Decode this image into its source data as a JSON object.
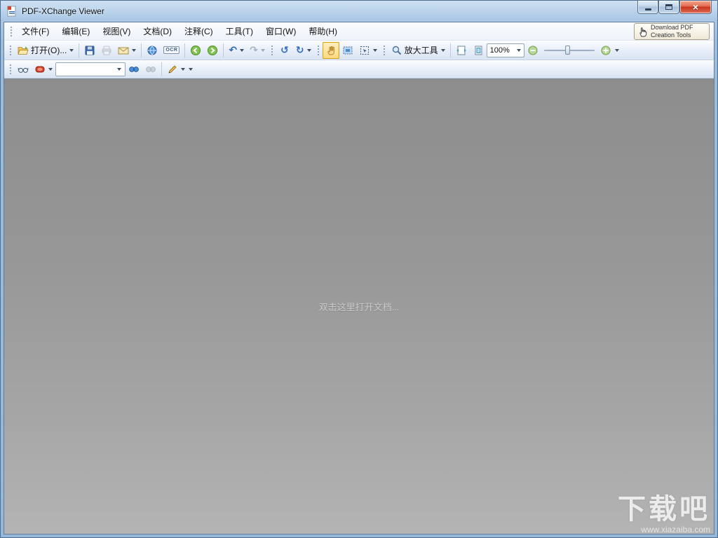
{
  "window": {
    "title": "PDF-XChange Viewer"
  },
  "menubar": {
    "items": [
      "文件(F)",
      "编辑(E)",
      "视图(V)",
      "文档(D)",
      "注释(C)",
      "工具(T)",
      "窗口(W)",
      "帮助(H)"
    ],
    "download_button": {
      "line1": "Download PDF",
      "line2": "Creation Tools"
    }
  },
  "toolbar1": {
    "open_label": "打开(O)...",
    "ocr_label": "OCR",
    "zoom_tool_label": "放大工具",
    "zoom_value": "100%"
  },
  "toolbar2": {
    "search_value": ""
  },
  "content": {
    "placeholder": "双击这里打开文档..."
  },
  "watermark": {
    "title": "下载吧",
    "url": "www.xiazaiba.com"
  },
  "glyphs": {
    "undo": "↶",
    "redo": "↷",
    "rotate_ccw": "↺",
    "rotate_cw": "↻"
  },
  "icons": [
    "app-icon",
    "minimize-icon",
    "maximize-icon",
    "close-icon",
    "grip-handle",
    "open-folder-icon",
    "save-icon",
    "print-icon",
    "email-icon",
    "browser-icon",
    "ocr-icon",
    "previous-view-icon",
    "next-view-icon",
    "undo-icon",
    "redo-icon",
    "rotate-ccw-icon",
    "rotate-cw-icon",
    "hand-tool-icon",
    "snapshot-icon",
    "select-tool-icon",
    "magnifier-icon",
    "fit-width-icon",
    "fit-page-icon",
    "zoom-out-icon",
    "zoom-in-icon",
    "glasses-icon",
    "stamp-icon",
    "search-icon",
    "search-again-icon",
    "pen-icon",
    "hand-cursor-icon",
    "dropdown-caret-icon"
  ]
}
